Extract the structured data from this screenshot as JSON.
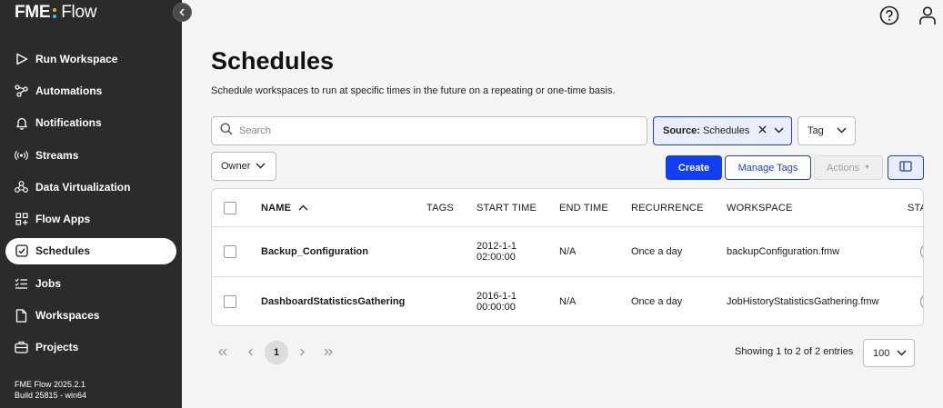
{
  "app": {
    "logo_left": "FME",
    "logo_right": "Flow",
    "version_line1": "FME Flow 2025.2.1",
    "version_line2": "Build 25815 - win64"
  },
  "sidebar": {
    "items": [
      {
        "label": "Run Workspace",
        "icon": "play-icon"
      },
      {
        "label": "Automations",
        "icon": "automations-icon"
      },
      {
        "label": "Notifications",
        "icon": "bell-icon"
      },
      {
        "label": "Streams",
        "icon": "streams-icon"
      },
      {
        "label": "Data Virtualization",
        "icon": "data-virtualization-icon"
      },
      {
        "label": "Flow Apps",
        "icon": "flow-apps-icon"
      },
      {
        "label": "Schedules",
        "icon": "calendar-check-icon",
        "active": true
      },
      {
        "label": "Jobs",
        "icon": "jobs-list-icon"
      },
      {
        "label": "Workspaces",
        "icon": "workspaces-file-icon"
      },
      {
        "label": "Projects",
        "icon": "projects-briefcase-icon"
      }
    ]
  },
  "header": {
    "help_icon": "help-icon",
    "user_icon": "user-icon"
  },
  "main": {
    "title": "Schedules",
    "description": "Schedule workspaces to run at specific times in the future on a repeating or one-time basis.",
    "search_placeholder": "Search",
    "source_filter_key": "Source:",
    "source_filter_value": "Schedules",
    "tag_filter": "Tag",
    "owner_filter": "Owner",
    "create_label": "Create",
    "manage_tags_label": "Manage Tags",
    "actions_label": "Actions"
  },
  "table": {
    "columns": [
      "NAME",
      "TAGS",
      "START TIME",
      "END TIME",
      "RECURRENCE",
      "WORKSPACE",
      "STA"
    ],
    "rows": [
      {
        "name": "Backup_Configuration",
        "tags": "",
        "start_date": "2012-1-1",
        "start_time": "02:00:00",
        "end_time": "N/A",
        "recurrence": "Once a day",
        "workspace": "backupConfiguration.fmw"
      },
      {
        "name": "DashboardStatisticsGathering",
        "tags": "",
        "start_date": "2016-1-1",
        "start_time": "00:00:00",
        "end_time": "N/A",
        "recurrence": "Once a day",
        "workspace": "JobHistoryStatisticsGathering.fmw"
      }
    ]
  },
  "pagination": {
    "current_page": "1",
    "entries_text": "Showing 1 to 2 of 2 entries",
    "page_size": "100"
  },
  "colors": {
    "sidebar_bg": "#2b2b2b",
    "primary_blue": "#0f3ff0",
    "logo_dot_top": "#f5a623",
    "logo_dot_bottom": "#2ec4f1",
    "page_bg": "#f4f4f4"
  }
}
